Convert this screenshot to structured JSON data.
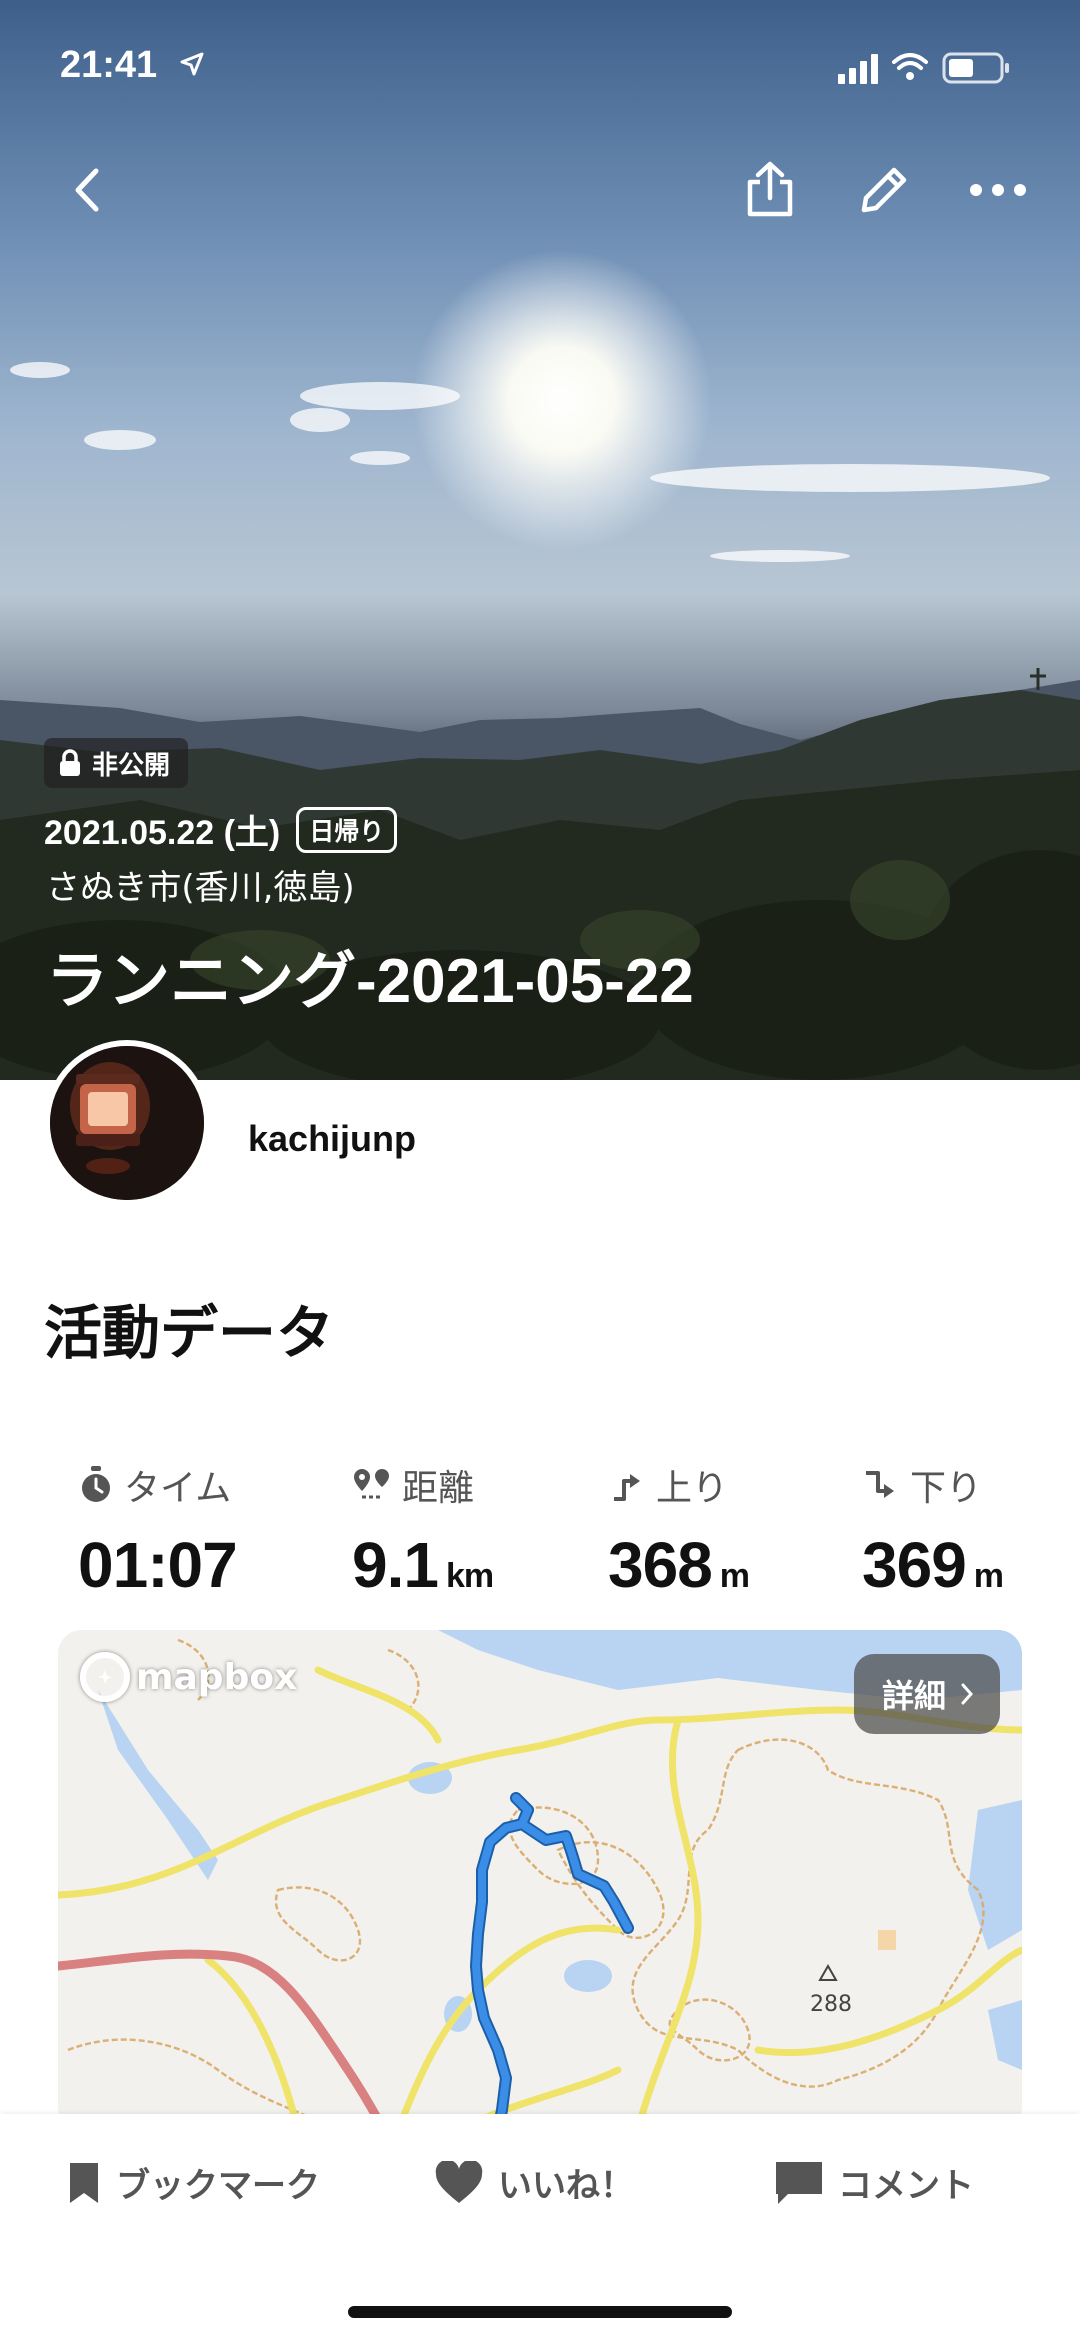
{
  "status_bar": {
    "time": "21:41"
  },
  "hero": {
    "privacy_label": "非公開",
    "date": "2021.05.22 (土)",
    "trip_type": "日帰り",
    "location": "さぬき市(香川,徳島)",
    "title": "ランニング-2021-05-22"
  },
  "user": {
    "name": "kachijunp"
  },
  "section_title": "活動データ",
  "stats": {
    "time": {
      "label": "タイム",
      "value": "01:07",
      "unit": ""
    },
    "distance": {
      "label": "距離",
      "value": "9.1",
      "unit": "km"
    },
    "ascent": {
      "label": "上り",
      "value": "368",
      "unit": "m"
    },
    "descent": {
      "label": "下り",
      "value": "369",
      "unit": "m"
    }
  },
  "map": {
    "provider": "mapbox",
    "detail_label": "詳細",
    "peak_label": "288",
    "route_color": "#3b8ee8"
  },
  "actions": {
    "bookmark": "ブックマーク",
    "like": "いいね！",
    "comment": "コメント"
  },
  "icons": [
    "back-icon",
    "share-icon",
    "edit-icon",
    "more-icon",
    "lock-icon",
    "stopwatch-icon",
    "distance-icon",
    "ascent-icon",
    "descent-icon",
    "bookmark-icon",
    "heart-icon",
    "comment-icon"
  ]
}
